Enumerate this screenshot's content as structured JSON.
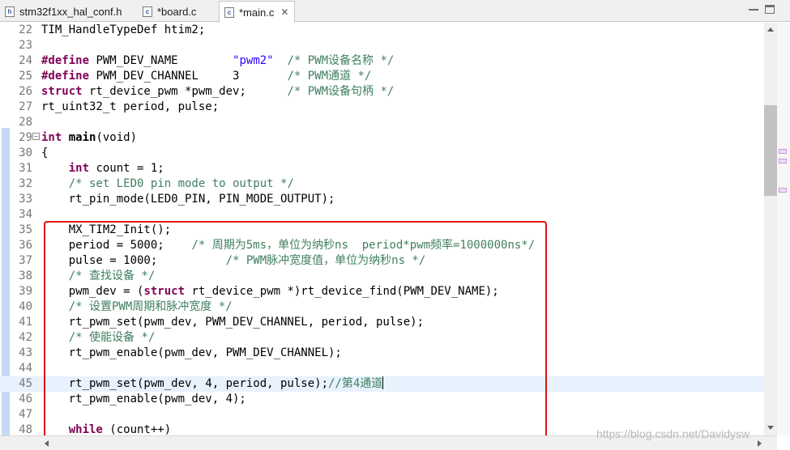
{
  "tabs": [
    {
      "label": "stm32f1xx_hal_conf.h",
      "icon": "h-file-icon",
      "active": false
    },
    {
      "label": "*board.c",
      "icon": "c-file-icon",
      "active": false
    },
    {
      "label": "*main.c",
      "icon": "c-file-icon",
      "active": true,
      "close": "✕"
    }
  ],
  "tab_icon_letters": {
    "h": "h",
    "c": "c"
  },
  "editor": {
    "current_line": 45,
    "lines": [
      {
        "n": "22",
        "text": "TIM_HandleTypeDef htim2;"
      },
      {
        "n": "23",
        "text": ""
      },
      {
        "n": "24",
        "kw": "#define",
        "text": " PWM_DEV_NAME        ",
        "str": "\"pwm2\"",
        "cm": "  /* PWM设备名称 */"
      },
      {
        "n": "25",
        "kw": "#define",
        "text": " PWM_DEV_CHANNEL     3      ",
        "cm": " /* PWM通道 */"
      },
      {
        "n": "26",
        "kw": "struct",
        "text": " rt_device_pwm *pwm_dev;      ",
        "cm": "/* PWM设备句柄 */"
      },
      {
        "n": "27",
        "text": "rt_uint32_t period, pulse;"
      },
      {
        "n": "28",
        "text": ""
      },
      {
        "n": "29",
        "kw": "int",
        "bold": " main",
        "text": "(void)"
      },
      {
        "n": "30",
        "text": "{"
      },
      {
        "n": "31",
        "indent": "    ",
        "kw": "int",
        "text": " count = 1;"
      },
      {
        "n": "32",
        "indent": "    ",
        "cm": "/* set LED0 pin mode to output */"
      },
      {
        "n": "33",
        "text": "    rt_pin_mode(LED0_PIN, PIN_MODE_OUTPUT);"
      },
      {
        "n": "34",
        "text": ""
      },
      {
        "n": "35",
        "text": "    MX_TIM2_Init();"
      },
      {
        "n": "36",
        "text": "    period = 5000;    ",
        "cm": "/* 周期为5ms，单位为纳秒ns  period*pwm频率=1000000ns*/"
      },
      {
        "n": "37",
        "text": "    pulse = 1000;          ",
        "cm": "/* PWM脉冲宽度值，单位为纳秒ns */"
      },
      {
        "n": "38",
        "indent": "    ",
        "cm": "/* 查找设备 */"
      },
      {
        "n": "39",
        "text": "    pwm_dev = (",
        "kw": "struct",
        "text2": " rt_device_pwm *)rt_device_find(PWM_DEV_NAME);"
      },
      {
        "n": "40",
        "indent": "    ",
        "cm": "/* 设置PWM周期和脉冲宽度 */"
      },
      {
        "n": "41",
        "text": "    rt_pwm_set(pwm_dev, PWM_DEV_CHANNEL, period, pulse);"
      },
      {
        "n": "42",
        "indent": "    ",
        "cm": "/* 使能设备 */"
      },
      {
        "n": "43",
        "text": "    rt_pwm_enable(pwm_dev, PWM_DEV_CHANNEL);"
      },
      {
        "n": "44",
        "text": ""
      },
      {
        "n": "45",
        "text": "    rt_pwm_set(pwm_dev, 4, period, pulse);",
        "cm": "//第4通道"
      },
      {
        "n": "46",
        "text": "    rt_pwm_enable(pwm_dev, 4);"
      },
      {
        "n": "47",
        "text": ""
      },
      {
        "n": "48",
        "indent": "    ",
        "kw": "while",
        "text": " (count++)"
      }
    ]
  },
  "watermark": "https://blog.csdn.net/Davidysw"
}
